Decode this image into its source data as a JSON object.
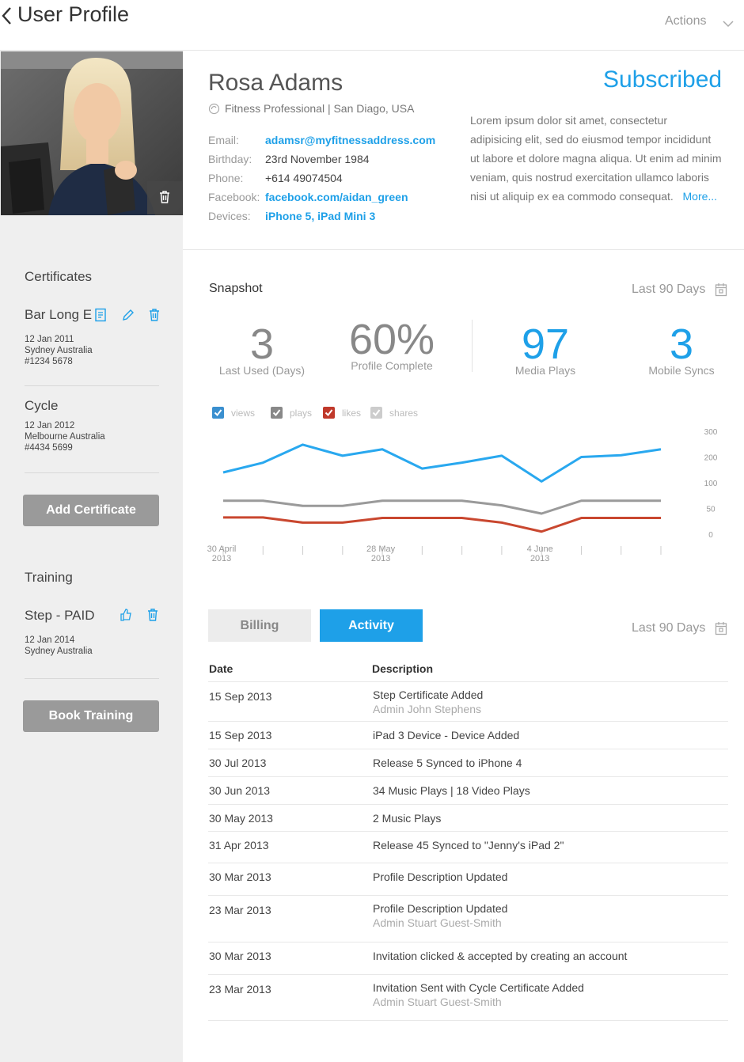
{
  "header": {
    "title": "User Profile",
    "actions_label": "Actions"
  },
  "profile": {
    "name": "Rosa Adams",
    "subtitle": "Fitness Professional | San Diago, USA",
    "status": "Subscribed",
    "fields": [
      {
        "label": "Email:",
        "value": "adamsr@myfitnessaddress.com",
        "link": true
      },
      {
        "label": "Birthday:",
        "value": "23rd November 1984",
        "link": false
      },
      {
        "label": "Phone:",
        "value": "+614 49074504",
        "link": false
      },
      {
        "label": "Facebook:",
        "value": "facebook.com/aidan_green",
        "link": true
      },
      {
        "label": "Devices:",
        "value": "iPhone 5, iPad Mini 3",
        "link": true
      }
    ],
    "bio": "Lorem ipsum dolor sit amet, consectetur adipisicing elit, sed do eiusmod tempor incididunt ut labore et dolore magna aliqua. Ut enim ad minim veniam, quis nostrud exercitation ullamco laboris nisi ut aliquip ex ea commodo consequat.",
    "bio_more": "More..."
  },
  "sidebar": {
    "certificates_title": "Certificates",
    "certificates": [
      {
        "name": "Bar Long E",
        "date": "12 Jan 2011",
        "location": "Sydney Australia",
        "number": "#1234 5678"
      },
      {
        "name": "Cycle",
        "date": "12 Jan 2012",
        "location": "Melbourne Australia",
        "number": "#4434 5699"
      }
    ],
    "add_certificate_label": "Add Certificate",
    "training_title": "Training",
    "training": [
      {
        "name": "Step - PAID",
        "date": "12 Jan 2014",
        "location": "Sydney Australia"
      }
    ],
    "book_training_label": "Book Training"
  },
  "snapshot": {
    "title": "Snapshot",
    "range_label": "Last 90 Days",
    "stats": [
      {
        "value": "3",
        "label": "Last Used (Days)"
      },
      {
        "value": "60%",
        "label": "Profile Complete"
      },
      {
        "value": "97",
        "label": "Media Plays"
      },
      {
        "value": "3",
        "label": "Mobile Syncs"
      }
    ],
    "legend": [
      {
        "name": "views",
        "color": "#3a8fcf",
        "checked": true
      },
      {
        "name": "plays",
        "color": "#888888",
        "checked": true
      },
      {
        "name": "likes",
        "color": "#c0392b",
        "checked": true
      },
      {
        "name": "shares",
        "color": "#cccccc",
        "checked": true
      }
    ]
  },
  "chart_data": {
    "type": "line",
    "x_tick_labels": [
      {
        "line1": "30 April",
        "line2": "2013",
        "index": 0
      },
      {
        "line1": "28 May",
        "line2": "2013",
        "index": 4
      },
      {
        "line1": "4 June",
        "line2": "2013",
        "index": 8
      }
    ],
    "y_ticks": [
      0,
      50,
      100,
      200,
      300
    ],
    "y_tick_positions": [
      0,
      1,
      2,
      3,
      4
    ],
    "series": [
      {
        "name": "views",
        "color": "#29a8ef",
        "values": [
          2.4,
          2.78,
          3.48,
          3.05,
          3.3,
          2.55,
          2.78,
          3.05,
          2.05,
          3.0,
          3.07,
          3.3
        ]
      },
      {
        "name": "plays",
        "color": "#9a9a9a",
        "values": [
          1.3,
          1.3,
          1.1,
          1.1,
          1.3,
          1.3,
          1.3,
          1.12,
          0.8,
          1.3,
          1.3,
          1.3
        ]
      },
      {
        "name": "likes",
        "color": "#c9472f",
        "values": [
          0.65,
          0.65,
          0.45,
          0.45,
          0.63,
          0.63,
          0.63,
          0.45,
          0.1,
          0.63,
          0.63,
          0.63
        ]
      }
    ]
  },
  "activity": {
    "tabs": {
      "billing": "Billing",
      "activity": "Activity"
    },
    "range_label": "Last 90 Days",
    "columns": {
      "date": "Date",
      "description": "Description"
    },
    "rows": [
      {
        "date": "15 Sep 2013",
        "desc": "Step Certificate Added",
        "sub": "Admin John Stephens"
      },
      {
        "date": "15 Sep 2013",
        "desc": "iPad 3 Device - Device Added",
        "sub": ""
      },
      {
        "date": "30 Jul 2013",
        "desc": "Release 5 Synced to iPhone 4",
        "sub": ""
      },
      {
        "date": "30 Jun 2013",
        "desc": "34 Music Plays | 18 Video Plays",
        "sub": ""
      },
      {
        "date": "30 May 2013",
        "desc": "2 Music Plays",
        "sub": ""
      },
      {
        "date": "31 Apr 2013",
        "desc": "Release 45 Synced to \"Jenny's iPad 2\"",
        "sub": ""
      },
      {
        "date": "30 Mar 2013",
        "desc": "Profile Description Updated",
        "sub": ""
      },
      {
        "date": "23 Mar 2013",
        "desc": "Profile Description Updated",
        "sub": "Admin Stuart Guest-Smith"
      },
      {
        "date": "30 Mar 2013",
        "desc": "Invitation clicked & accepted by creating an account",
        "sub": ""
      },
      {
        "date": "23 Mar 2013",
        "desc": "Invitation Sent with Cycle Certificate Added",
        "sub": "Admin Stuart Guest-Smith"
      }
    ]
  }
}
